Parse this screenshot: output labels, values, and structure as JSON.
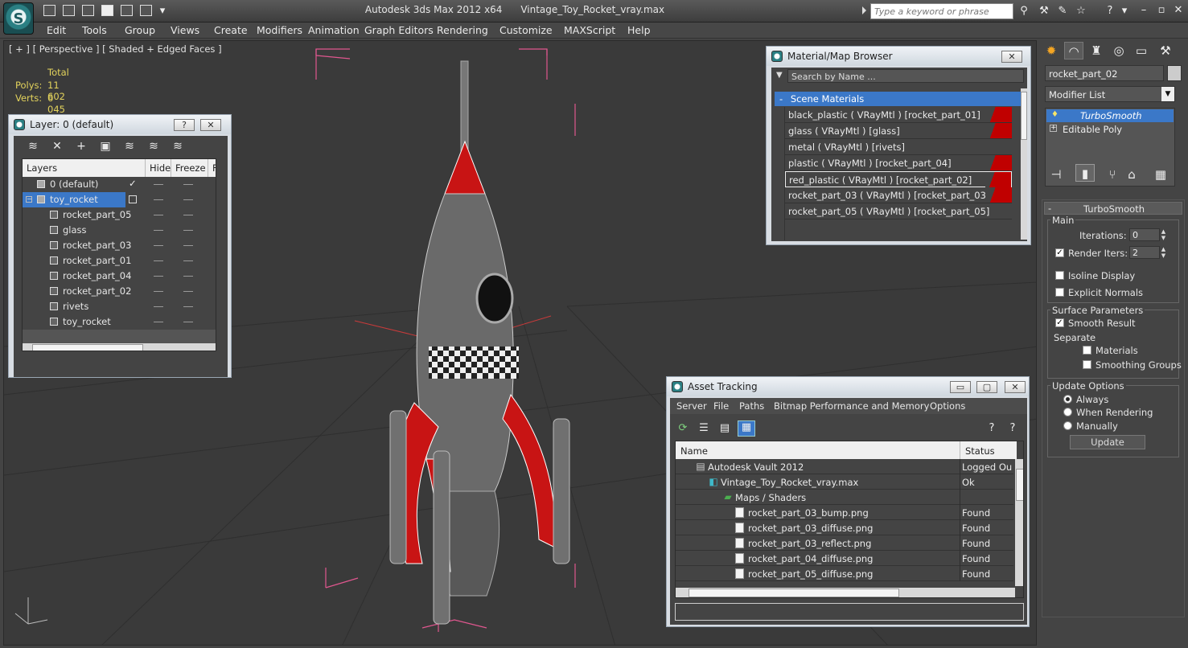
{
  "titlebar": {
    "app_name": "Autodesk 3ds Max  2012 x64",
    "file_name": "Vintage_Toy_Rocket_vray.max",
    "search_placeholder": "Type a keyword or phrase"
  },
  "menu": [
    "Edit",
    "Tools",
    "Group",
    "Views",
    "Create",
    "Modifiers",
    "Animation",
    "Graph Editors",
    "Rendering",
    "Customize",
    "MAXScript",
    "Help"
  ],
  "viewport": {
    "label": "[ + ] [ Perspective ] [ Shaded + Edged Faces ]",
    "stats_header": "Total",
    "polys_label": "Polys:",
    "polys_value": "11 602",
    "verts_label": "Verts:",
    "verts_value": "6 045"
  },
  "layer_panel": {
    "title": "Layer: 0 (default)",
    "help_btn": "?",
    "close_btn": "✕",
    "columns": {
      "layers": "Layers",
      "hide": "Hide",
      "freeze": "Freeze",
      "render": "F"
    },
    "rows": [
      {
        "name": "0 (default)",
        "level": 0,
        "type": "layer",
        "check": "✓"
      },
      {
        "name": "toy_rocket",
        "level": 0,
        "type": "layer",
        "selected": true
      },
      {
        "name": "rocket_part_05",
        "level": 1,
        "type": "object"
      },
      {
        "name": "glass",
        "level": 1,
        "type": "object"
      },
      {
        "name": "rocket_part_03",
        "level": 1,
        "type": "object"
      },
      {
        "name": "rocket_part_01",
        "level": 1,
        "type": "object"
      },
      {
        "name": "rocket_part_04",
        "level": 1,
        "type": "object"
      },
      {
        "name": "rocket_part_02",
        "level": 1,
        "type": "object"
      },
      {
        "name": "rivets",
        "level": 1,
        "type": "object"
      },
      {
        "name": "toy_rocket",
        "level": 1,
        "type": "object"
      }
    ]
  },
  "material_browser": {
    "title": "Material/Map Browser",
    "close_btn": "✕",
    "search_placeholder": "Search by Name ...",
    "group_toggle": "-",
    "group_name": "Scene Materials",
    "items": [
      {
        "label": "black_plastic  ( VRayMtl )  [rocket_part_01]",
        "swatch": true
      },
      {
        "label": "glass  ( VRayMtl )  [glass]",
        "swatch": true
      },
      {
        "label": "metal  ( VRayMtl )  [rivets]",
        "swatch": false
      },
      {
        "label": "plastic  ( VRayMtl )  [rocket_part_04]",
        "swatch": true
      },
      {
        "label": "red_plastic  ( VRayMtl )  [rocket_part_02]",
        "swatch": true,
        "selected": true
      },
      {
        "label": "rocket_part_03  ( VRayMtl )  [rocket_part_03]",
        "swatch": true
      },
      {
        "label": "rocket_part_05  ( VRayMtl )  [rocket_part_05]",
        "swatch": false
      }
    ]
  },
  "asset_tracking": {
    "title": "Asset Tracking",
    "menu": [
      "Server",
      "File",
      "Paths",
      "Bitmap Performance and Memory",
      "Options"
    ],
    "columns": {
      "name": "Name",
      "status": "Status"
    },
    "rows": [
      {
        "name": "Autodesk Vault 2012",
        "status": "Logged Out",
        "indent": 24,
        "icon": "vault"
      },
      {
        "name": "Vintage_Toy_Rocket_vray.max",
        "status": "Ok",
        "indent": 40,
        "icon": "max"
      },
      {
        "name": "Maps / Shaders",
        "status": "",
        "indent": 58,
        "icon": "maps"
      },
      {
        "name": "rocket_part_03_bump.png",
        "status": "Found",
        "indent": 74,
        "icon": "file"
      },
      {
        "name": "rocket_part_03_diffuse.png",
        "status": "Found",
        "indent": 74,
        "icon": "file"
      },
      {
        "name": "rocket_part_03_reflect.png",
        "status": "Found",
        "indent": 74,
        "icon": "file"
      },
      {
        "name": "rocket_part_04_diffuse.png",
        "status": "Found",
        "indent": 74,
        "icon": "file"
      },
      {
        "name": "rocket_part_05_diffuse.png",
        "status": "Found",
        "indent": 74,
        "icon": "file"
      }
    ]
  },
  "command_panel": {
    "object_name": "rocket_part_02",
    "modifier_list": "Modifier List",
    "stack": [
      {
        "name": "TurboSmooth",
        "selected": true
      },
      {
        "name": "Editable Poly",
        "selected": false
      }
    ],
    "rollout_title": "TurboSmooth",
    "rollout_toggle": "-",
    "main_group": "Main",
    "iterations_label": "Iterations:",
    "iterations_value": "0",
    "render_iters_label": "Render Iters:",
    "render_iters_value": "2",
    "render_iters_checked": true,
    "isoline_label": "Isoline Display",
    "explicit_label": "Explicit Normals",
    "surface_group": "Surface Parameters",
    "smooth_result_label": "Smooth Result",
    "separate_label": "Separate",
    "materials_label": "Materials",
    "smoothing_groups_label": "Smoothing Groups",
    "update_group": "Update Options",
    "always_label": "Always",
    "when_rendering_label": "When Rendering",
    "manually_label": "Manually",
    "update_button": "Update"
  },
  "colors": {
    "selection_blue": "#3b78c8",
    "stat_yellow": "#e3d35c",
    "bbox_pink": "#e0578f",
    "rocket_red": "#c81414"
  }
}
